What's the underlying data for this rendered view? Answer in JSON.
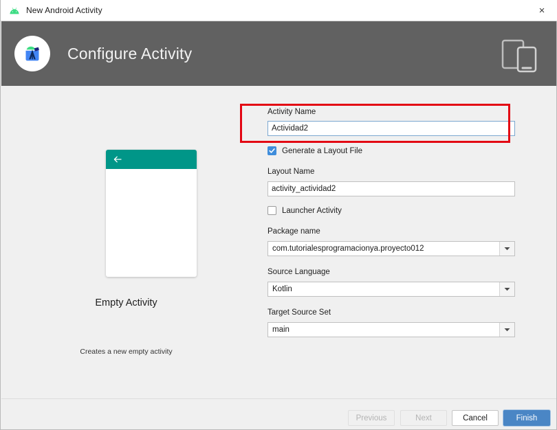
{
  "window": {
    "title": "New Android Activity",
    "icon": "android-icon",
    "close_label": "×"
  },
  "header": {
    "title": "Configure Activity",
    "logo_icon": "android-studio-logo-icon",
    "device_icon": "tablet-and-phone-icon"
  },
  "preview": {
    "template_name": "Empty Activity",
    "description": "Creates a new empty activity",
    "back_icon": "back-arrow-icon",
    "appbar_color": "#009688"
  },
  "form": {
    "activity_name": {
      "label": "Activity Name",
      "value": "Actividad2",
      "placeholder": ""
    },
    "generate_layout": {
      "label": "Generate a Layout File",
      "checked": true,
      "check_glyph": "✓"
    },
    "layout_name": {
      "label": "Layout Name",
      "value": "activity_actividad2",
      "placeholder": ""
    },
    "launcher_activity": {
      "label": "Launcher Activity",
      "checked": false
    },
    "package_name": {
      "label": "Package name",
      "value": "com.tutorialesprogramacionya.proyecto012",
      "dropdown_icon": "chevron-down-icon"
    },
    "source_language": {
      "label": "Source Language",
      "value": "Kotlin",
      "dropdown_icon": "chevron-down-icon"
    },
    "target_source_set": {
      "label": "Target Source Set",
      "value": "main",
      "dropdown_icon": "chevron-down-icon"
    }
  },
  "annotation": {
    "color": "#e30613",
    "targets": "activity-name-field"
  },
  "footer": {
    "previous_label": "Previous",
    "next_label": "Next",
    "cancel_label": "Cancel",
    "finish_label": "Finish"
  }
}
